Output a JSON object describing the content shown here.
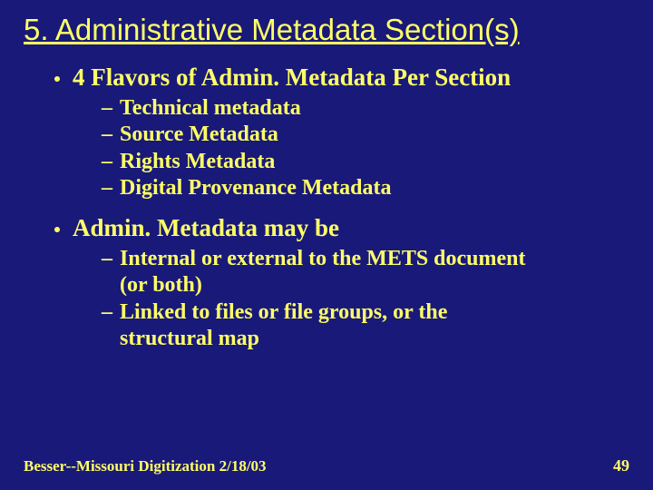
{
  "title": "5. Administrative Metadata Section(s)",
  "sections": [
    {
      "heading": "4 Flavors of Admin. Metadata Per Section",
      "items": [
        "Technical metadata",
        "Source Metadata",
        "Rights Metadata",
        "Digital Provenance Metadata"
      ]
    },
    {
      "heading": "Admin. Metadata may be",
      "items": [
        "Internal or external to the METS document (or both)",
        "Linked to files or file groups, or the structural map"
      ]
    }
  ],
  "footer": "Besser--Missouri Digitization   2/18/03",
  "page_number": "49"
}
